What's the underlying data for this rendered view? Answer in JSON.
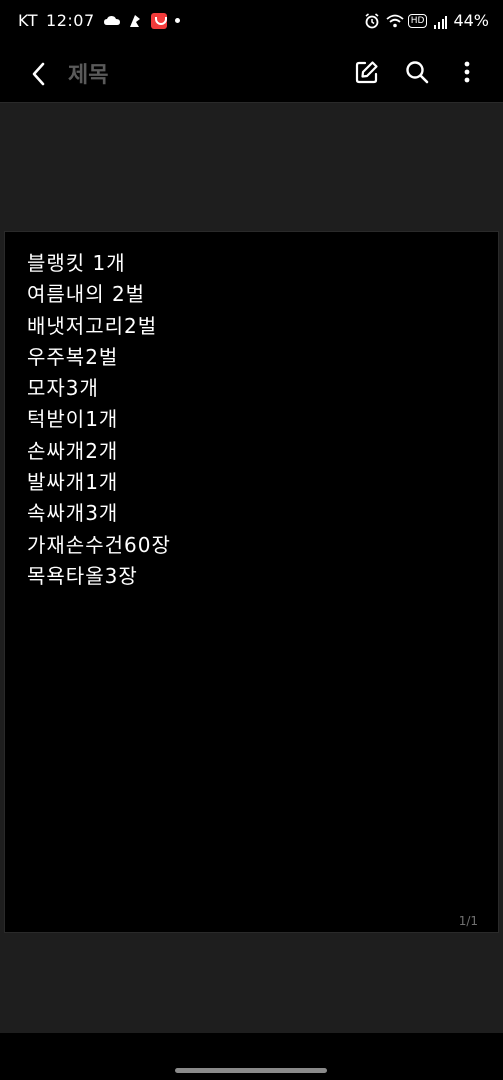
{
  "status": {
    "carrier": "KT",
    "time": "12:07",
    "battery": "44%"
  },
  "header": {
    "title": "제목",
    "icons": {
      "back": "chevron-left-icon",
      "edit": "edit-icon",
      "search": "search-icon",
      "more": "more-vertical-icon"
    }
  },
  "note": {
    "lines": [
      "블랭킷 1개",
      "여름내의 2벌",
      "배냇저고리2벌",
      "우주복2벌",
      "모자3개",
      "턱받이1개",
      "손싸개2개",
      "발싸개1개",
      "속싸개3개",
      "가재손수건60장",
      "목욕타올3장"
    ],
    "page_indicator": "1/1"
  },
  "colors": {
    "background": "#000000",
    "canvas": "#1e1e1e",
    "title_color": "#5a5a5a"
  }
}
